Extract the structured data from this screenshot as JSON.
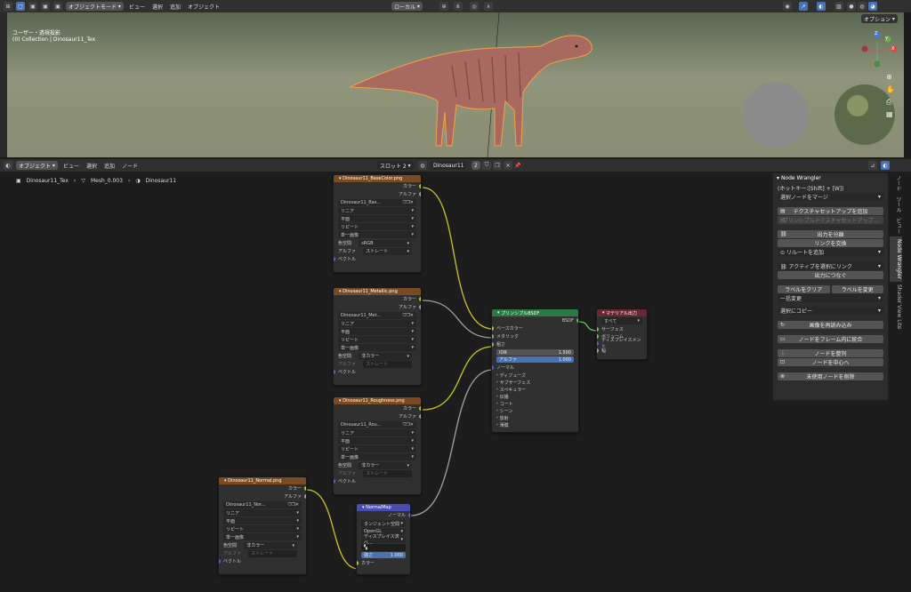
{
  "top_header": {
    "mode": "オブジェクトモード",
    "menus": [
      "ビュー",
      "選択",
      "追加",
      "オブジェクト"
    ],
    "transform": "ローカル",
    "options": "オプション"
  },
  "viewport": {
    "view_label": "ユーザー・透視投影",
    "collection": "(0) Collection | Dinosaur11_Tex",
    "gizmo": {
      "z": "Z",
      "y": "Y",
      "x": "X"
    }
  },
  "node_header": {
    "mode": "オブジェクト",
    "menus": [
      "ビュー",
      "選択",
      "追加",
      "ノード"
    ],
    "slot": "スロット 2",
    "material": "Dinosaur11",
    "users": "2"
  },
  "breadcrumb": [
    "Dinosaur11_Tex",
    "Mesh_0.003",
    "Dinosaur11"
  ],
  "nodes": {
    "basecolor": {
      "title": "Dinosaur11_BaseColor.png",
      "image": "Dinosaur11_Bas...",
      "interp": "リニア",
      "proj": "平面",
      "ext": "リピート",
      "src": "単一画像",
      "cs_label": "色空間",
      "cs": "sRGB",
      "alpha_label": "アルファ",
      "alpha": "ストレート"
    },
    "metallic": {
      "title": "Dinosaur11_Metallic.png",
      "image": "Dinosaur11_Met...",
      "interp": "リニア",
      "proj": "平面",
      "ext": "リピート",
      "src": "単一画像",
      "cs_label": "色空間",
      "cs": "非カラー",
      "alpha_label": "アルファ",
      "alpha": "ストレート"
    },
    "roughness": {
      "title": "Dinosaur11_Roughness.png",
      "image": "Dinosaur11_Rou...",
      "interp": "リニア",
      "proj": "平面",
      "ext": "リピート",
      "src": "単一画像",
      "cs_label": "色空間",
      "cs": "非カラー",
      "alpha_label": "アルファ",
      "alpha": "ストレート"
    },
    "normal": {
      "title": "Dinosaur11_Normal.png",
      "image": "Dinosaur11_Nor...",
      "interp": "リニア",
      "proj": "平面",
      "ext": "リピート",
      "src": "単一画像",
      "cs_label": "色空間",
      "cs": "非カラー",
      "alpha_label": "アルファ",
      "alpha": "ストレート"
    },
    "sock": {
      "color": "カラー",
      "alpha": "アルファ",
      "vector": "ベクトル"
    },
    "bsdf": {
      "title": "プリンシプルBSDF",
      "out": "BSDF",
      "base": "ベースカラー",
      "metal": "メタリック",
      "rough": "粗さ",
      "ior_label": "IOR",
      "ior": "1.500",
      "alpha_label": "アルファ",
      "alpha": "1.000",
      "normal": "ノーマル",
      "sections": [
        "ディフューズ",
        "サブサーフェス",
        "スペキュラー",
        "伝播",
        "コート",
        "シーン",
        "放射",
        "薄膜"
      ]
    },
    "output": {
      "title": "マテリアル出力",
      "target": "すべて",
      "surface": "サーフェス",
      "volume": "ボリューム",
      "disp": "ディスプレイスメント",
      "thick": "幅"
    },
    "normalmap": {
      "title": "NormalMap",
      "out": "ノーマル",
      "space": "タンジェント空間",
      "opengl": "OpenGL",
      "disp": "ディスプレイス済ベ...",
      "strength_label": "強さ",
      "strength": "1.000",
      "color": "カラー"
    }
  },
  "panel": {
    "title": "Node Wrangler",
    "hotkey": "(ホットキー:[Shift] + [W])",
    "merge": "選択ノードをマージ",
    "tex_setup": "テクスチャセットアップを追加",
    "principled_setup": "プリンシプルテクスチャセットアップ...",
    "split_out": "出力を分離",
    "swap_links": "リンクを交換",
    "add_reroute": "リルートを追加",
    "link_active": "アクティブを選択にリンク",
    "connect_out": "出力につなぐ",
    "clear_label": "ラベルをクリア",
    "change_label": "ラベルを変更",
    "batch": "一括変更",
    "copy_sel": "選択にコピー",
    "reload": "画像を再読み込み",
    "frame": "ノードをフレーム内に統合",
    "align": "ノードを整列",
    "center": "ノードを中心へ",
    "delete_unused": "未使用ノードを削除"
  },
  "tabs": [
    "ノード",
    "ツール",
    "ビュー",
    "Node Wrangler",
    "Shader View Lite"
  ],
  "colors": {
    "accent": "#4772b3",
    "texture_header": "#7a4b22",
    "bsdf_header": "#2b7a43",
    "output_header": "#6b2734",
    "normalmap_header": "#4b4bb0",
    "link_yellow": "#c7c729",
    "link_gray": "#a1a1a1"
  }
}
